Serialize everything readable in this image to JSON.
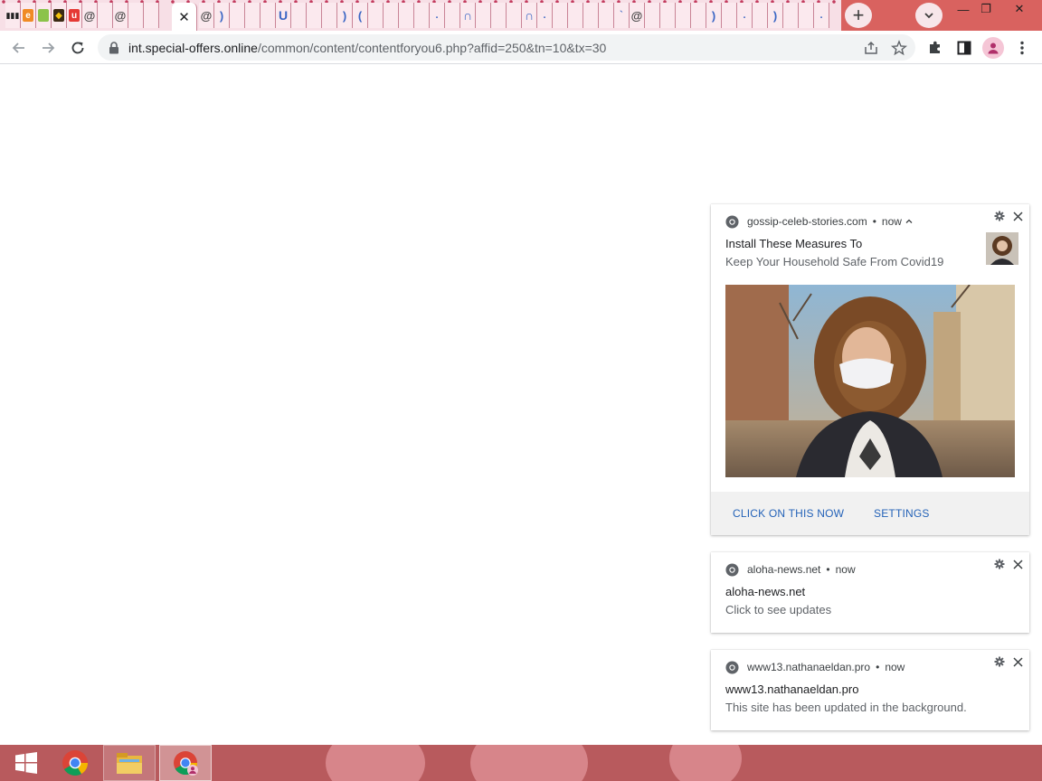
{
  "browser": {
    "url_host": "int.special-offers.online",
    "url_path": "/common/content/contentforyou6.php?affid=250&tn=10&tx=30",
    "active_tab_close_glyph": "✕",
    "new_tab_glyph": "+",
    "minimize_glyph": "—",
    "restore_glyph": "❐",
    "close_glyph": "✕",
    "accent_color": "#d9625f"
  },
  "notifications": [
    {
      "site": "gossip-celeb-stories.com",
      "separator": "•",
      "time": "now",
      "title": "Install These Measures To",
      "body": "Keep Your Household Safe From Covid19",
      "actions": [
        "CLICK ON THIS NOW",
        "SETTINGS"
      ]
    },
    {
      "site": "aloha-news.net",
      "separator": "•",
      "time": "now",
      "title": "aloha-news.net",
      "body": "Click to see updates"
    },
    {
      "site": "www13.nathanaeldan.pro",
      "separator": "•",
      "time": "now",
      "title": "www13.nathanaeldan.pro",
      "body": "This site has been updated in the background."
    }
  ],
  "taskbar": {
    "items": [
      "start-icon",
      "chrome-icon",
      "file-explorer-icon",
      "chrome-profile-icon"
    ]
  }
}
